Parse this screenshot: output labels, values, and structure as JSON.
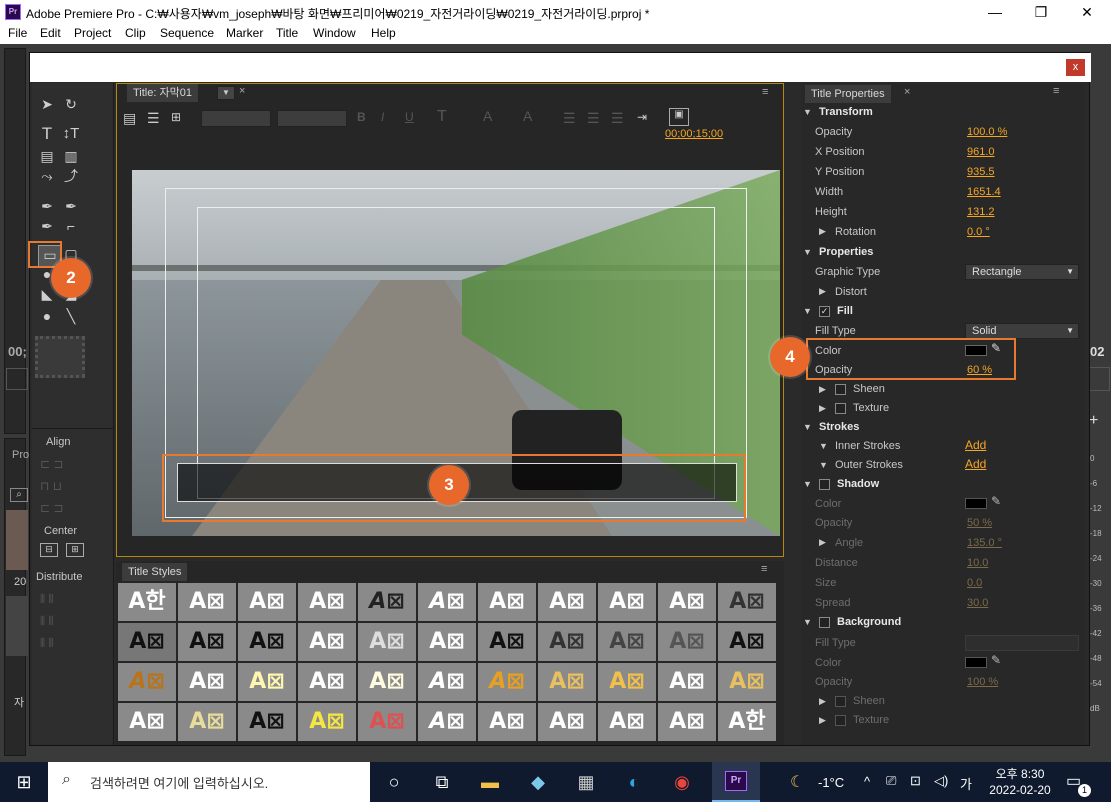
{
  "window": {
    "app_icon": "Pr",
    "title": "Adobe Premiere Pro - C:₩사용자₩vm_joseph₩바탕 화면₩프리미어₩0219_자전거라이딩₩0219_자전거라이딩.prproj *",
    "minimize": "—",
    "maximize": "❐",
    "close": "✕"
  },
  "menu": [
    "File",
    "Edit",
    "Project",
    "Clip",
    "Sequence",
    "Marker",
    "Title",
    "Window",
    "Help"
  ],
  "background": {
    "timecode_left": "00;",
    "timecode_right": "02",
    "project_tab": "Pro",
    "item_label": "20",
    "item_label2": "자",
    "audio_meter": [
      "0",
      "-6",
      "-12",
      "-18",
      "-24",
      "-30",
      "-36",
      "-42",
      "-48",
      "-54",
      "dB"
    ]
  },
  "dialog": {
    "close": "x"
  },
  "title_tab": {
    "label": "Title: 자막01",
    "timecode": "00;00;15;00"
  },
  "tools": {
    "align_label": "Align",
    "center_label": "Center",
    "distribute_label": "Distribute"
  },
  "markers": {
    "m2": "2",
    "m3": "3",
    "m4": "4"
  },
  "title_styles": {
    "label": "Title Styles",
    "cell_text": "A⊠",
    "first_cell": "A한"
  },
  "props": {
    "tab": "Title Properties",
    "transform": {
      "header": "Transform",
      "opacity_label": "Opacity",
      "opacity": "100.0 %",
      "x_label": "X Position",
      "x": "961.0",
      "y_label": "Y Position",
      "y": "935.5",
      "w_label": "Width",
      "w": "1651.4",
      "h_label": "Height",
      "h": "131.2",
      "rot_label": "Rotation",
      "rot": "0.0 °"
    },
    "properties": {
      "header": "Properties",
      "graphic_type_label": "Graphic Type",
      "graphic_type": "Rectangle",
      "distort": "Distort"
    },
    "fill": {
      "header": "Fill",
      "fill_type_label": "Fill Type",
      "fill_type": "Solid",
      "color_label": "Color",
      "color": "#000000",
      "opacity_label": "Opacity",
      "opacity": "60 %",
      "sheen": "Sheen",
      "texture": "Texture"
    },
    "strokes": {
      "header": "Strokes",
      "inner": "Inner Strokes",
      "outer": "Outer Strokes",
      "add": "Add"
    },
    "shadow": {
      "header": "Shadow",
      "color_label": "Color",
      "opacity_label": "Opacity",
      "opacity": "50 %",
      "angle_label": "Angle",
      "angle": "135.0 °",
      "distance_label": "Distance",
      "distance": "10.0",
      "size_label": "Size",
      "size": "0.0",
      "spread_label": "Spread",
      "spread": "30.0"
    },
    "background": {
      "header": "Background",
      "fill_type_label": "Fill Type",
      "color_label": "Color",
      "opacity_label": "Opacity",
      "opacity": "100 %",
      "sheen": "Sheen",
      "texture": "Texture"
    }
  },
  "taskbar": {
    "search_placeholder": "검색하려면 여기에 입력하십시오.",
    "weather": "-1°C",
    "ime": "가",
    "time": "오후 8:30",
    "date": "2022-02-20",
    "notif": "1"
  }
}
